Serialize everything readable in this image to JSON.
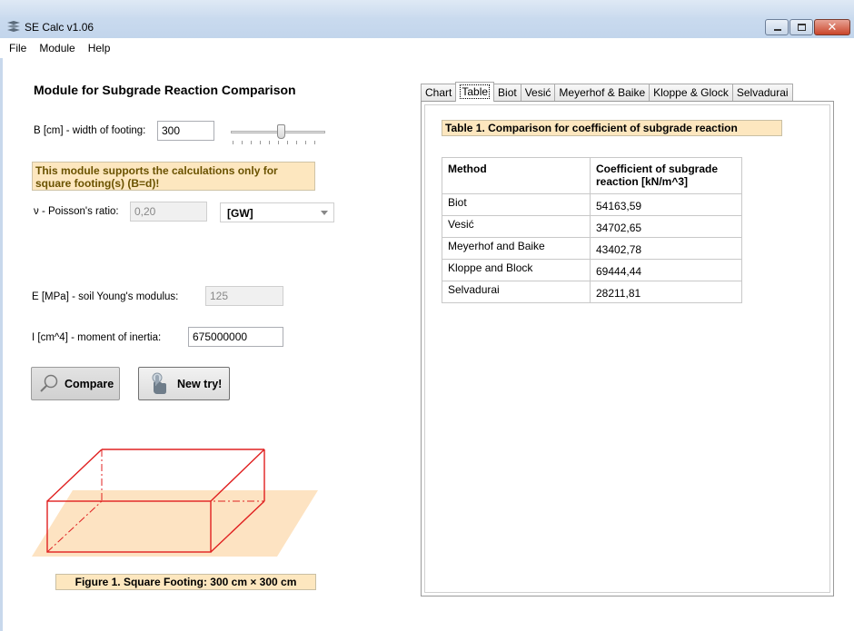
{
  "window": {
    "title": "SE Calc v1.06",
    "icon": "app-logo-icon",
    "controls": [
      "minimize-icon",
      "maximize-icon",
      "close-icon"
    ]
  },
  "menu": {
    "file": "File",
    "module": "Module",
    "help": "Help"
  },
  "module_title": "Module for Subgrade Reaction Comparison",
  "width_label": "B [cm] - width of footing:",
  "width_value": "300",
  "note": "This module  supports the calculations only for square footing(s) (B=d)!",
  "poisson_label": "ν - Poisson's ratio:",
  "poisson_value": "0,20",
  "soil_class": "[GW]",
  "young_label": "E [MPa] - soil Young's modulus:",
  "young_value": "125",
  "inertia_label": "I [cm^4] - moment of inertia:",
  "inertia_value": "675000000",
  "buttons": {
    "compare": "Compare",
    "new_try": "New try!"
  },
  "figure_caption": "Figure 1. Square Footing: 300 cm × 300 cm",
  "tabs": [
    "Chart",
    "Table",
    "Biot",
    "Vesić",
    "Meyerhof & Baike",
    "Kloppe & Glock",
    "Selvadurai"
  ],
  "active_tab": "Table",
  "table_caption": "Table 1. Comparison for coefficient of subgrade reaction",
  "table": {
    "headers": [
      "Method",
      "Coefficient of subgrade reaction [kN/m^3]"
    ],
    "rows": [
      [
        "Biot",
        "54163,59"
      ],
      [
        "Vesić",
        "34702,65"
      ],
      [
        "Meyerhof and Baike",
        "43402,78"
      ],
      [
        "Kloppe and Block",
        "69444,44"
      ],
      [
        "Selvadurai",
        "28211,81"
      ]
    ]
  },
  "colors": {
    "note_bg": "#fde7bf",
    "note_text": "#6a5200",
    "footing_edge": "#e02020",
    "ground": "#fde3c2"
  }
}
